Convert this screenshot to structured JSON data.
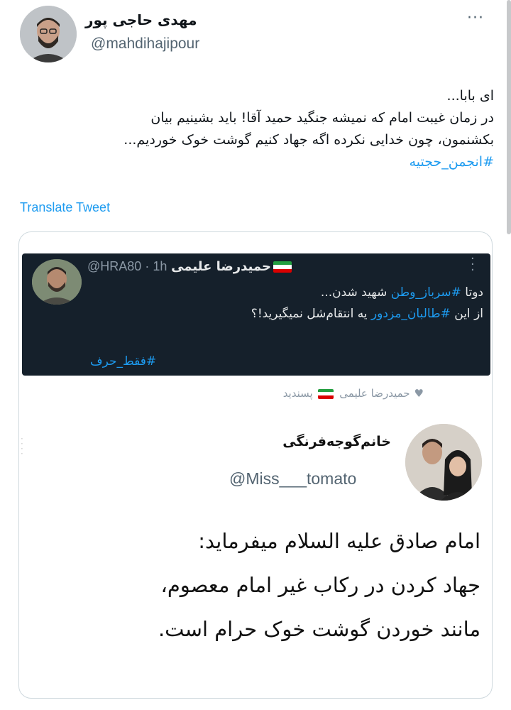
{
  "author": {
    "display_name": "مهدی حاجی پور",
    "handle": "@mahdihajipour"
  },
  "tweet": {
    "lines": [
      "ای بابا...",
      "در زمان غیبت امام که نمیشه جنگید حمید آقا! باید بشینیم بیان",
      "بکشنمون، چون خدایی نکرده اگه جهاد کنیم گوشت خوک خوردیم..."
    ],
    "hashtag": "#انجمن_حجتیه",
    "translate_label": "Translate Tweet"
  },
  "embedded": {
    "name": "حمیدرضا علیمی",
    "handle": "@HRA80",
    "time": "· 1h",
    "line1_pre": "دوتا ",
    "line1_tag": "#سرباز_وطن",
    "line1_post": " شهید شدن...",
    "line2_pre": "از این ",
    "line2_tag": "#طالبان_مزدور",
    "line2_post": " یه انتقام‌شل نمیگیرید!؟",
    "hashtag": "#فقط_حرف",
    "liked_name": "حمیدرضا علیمی",
    "liked_suffix": "پسندید"
  },
  "quoted": {
    "name": "خانم‌گوجه‌فرنگی",
    "handle": "@Miss___tomato",
    "lines": [
      "امام صادق علیه السلام میفرماید:",
      "جهاد کردن در رکاب غیر امام معصوم،",
      "مانند خوردن گوشت خوک حرام است."
    ]
  },
  "icons": {
    "more": "more-options-icon",
    "heart": "heart-icon",
    "flag": "iran-flag-icon"
  },
  "colors": {
    "link": "#1d9bf0",
    "secondary_text": "#536471",
    "dark_bg": "#15202b",
    "flag_green": "#239f40",
    "flag_red": "#da0000"
  }
}
